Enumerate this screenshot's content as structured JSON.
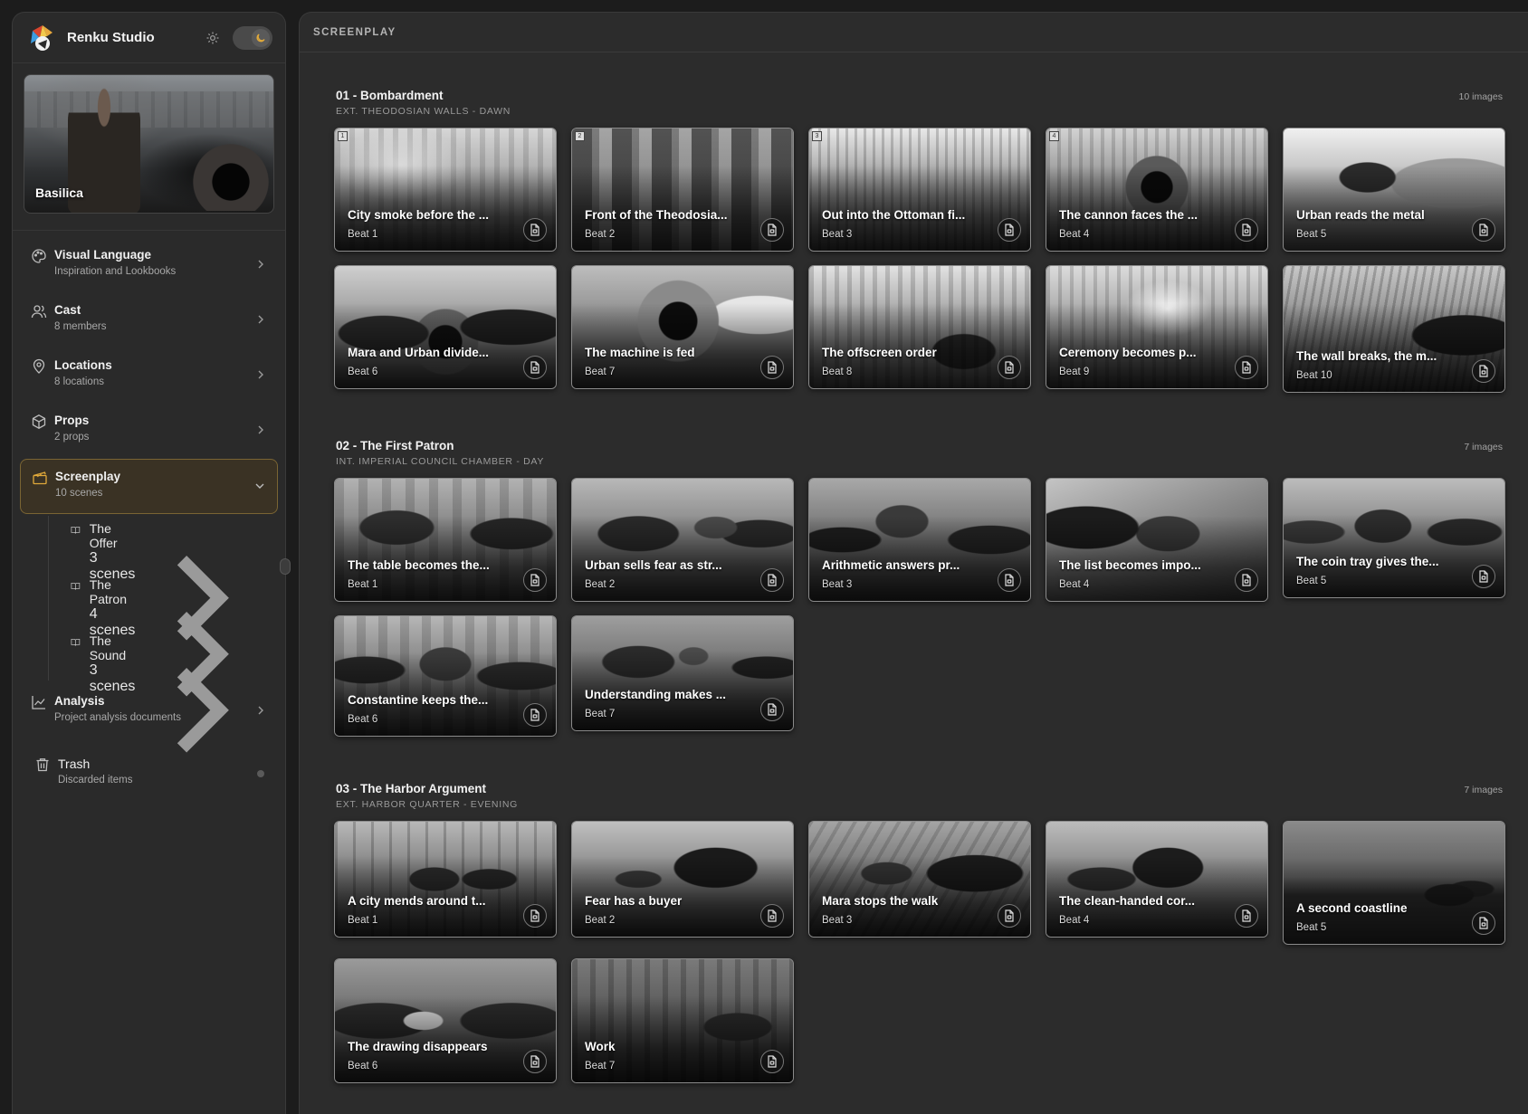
{
  "app": {
    "name": "Renku Studio"
  },
  "project": {
    "title": "Basilica"
  },
  "nav": {
    "visual_language": {
      "title": "Visual Language",
      "sub": "Inspiration and Lookbooks"
    },
    "cast": {
      "title": "Cast",
      "sub": "8 members"
    },
    "locations": {
      "title": "Locations",
      "sub": "8 locations"
    },
    "props": {
      "title": "Props",
      "sub": "2 props"
    },
    "screenplay": {
      "title": "Screenplay",
      "sub": "10 scenes"
    },
    "sequences": [
      {
        "title": "The Offer",
        "sub": "3 scenes"
      },
      {
        "title": "The Patron",
        "sub": "4 scenes"
      },
      {
        "title": "The Sound",
        "sub": "3 scenes"
      }
    ],
    "analysis": {
      "title": "Analysis",
      "sub": "Project analysis documents"
    },
    "trash": {
      "title": "Trash",
      "sub": "Discarded items"
    }
  },
  "main": {
    "header": "SCREENPLAY",
    "scenes": [
      {
        "title": "01 - Bombardment",
        "slug": "EXT. THEODOSIAN WALLS - DAWN",
        "count": "10 images",
        "beats": [
          {
            "title": "City smoke before the ...",
            "beat": "Beat 1",
            "badge": "1"
          },
          {
            "title": "Front of the Theodosia...",
            "beat": "Beat 2",
            "badge": "2"
          },
          {
            "title": "Out into the Ottoman fi...",
            "beat": "Beat 3",
            "badge": "3"
          },
          {
            "title": "The cannon faces the ...",
            "beat": "Beat 4",
            "badge": "4"
          },
          {
            "title": "Urban reads the metal",
            "beat": "Beat 5",
            "badge": ""
          },
          {
            "title": "Mara and Urban divide...",
            "beat": "Beat 6",
            "badge": ""
          },
          {
            "title": "The machine is fed",
            "beat": "Beat 7",
            "badge": ""
          },
          {
            "title": "The offscreen order",
            "beat": "Beat 8",
            "badge": ""
          },
          {
            "title": "Ceremony becomes p...",
            "beat": "Beat 9",
            "badge": ""
          },
          {
            "title": "The wall breaks, the m...",
            "beat": "Beat 10",
            "badge": ""
          }
        ]
      },
      {
        "title": "02 - The First Patron",
        "slug": "INT. IMPERIAL COUNCIL CHAMBER - DAY",
        "count": "7 images",
        "beats": [
          {
            "title": "The table becomes the...",
            "beat": "Beat 1"
          },
          {
            "title": "Urban sells fear as str...",
            "beat": "Beat 2"
          },
          {
            "title": "Arithmetic answers pr...",
            "beat": "Beat 3"
          },
          {
            "title": "The list becomes impo...",
            "beat": "Beat 4"
          },
          {
            "title": "The coin tray gives the...",
            "beat": "Beat 5"
          },
          {
            "title": "Constantine keeps the...",
            "beat": "Beat 6"
          },
          {
            "title": "Understanding makes ...",
            "beat": "Beat 7"
          }
        ]
      },
      {
        "title": "03 - The Harbor Argument",
        "slug": "EXT. HARBOR QUARTER - EVENING",
        "count": "7 images",
        "beats": [
          {
            "title": "A city mends around t...",
            "beat": "Beat 1"
          },
          {
            "title": "Fear has a buyer",
            "beat": "Beat 2"
          },
          {
            "title": "Mara stops the walk",
            "beat": "Beat 3"
          },
          {
            "title": "The clean-handed cor...",
            "beat": "Beat 4"
          },
          {
            "title": "A second coastline",
            "beat": "Beat 5"
          },
          {
            "title": "The drawing disappears",
            "beat": "Beat 6"
          },
          {
            "title": "Work",
            "beat": "Beat 7"
          }
        ]
      }
    ]
  },
  "colors": {
    "accent": "#e0a93a",
    "active_bg": "#3a3224",
    "active_border": "#7a6433"
  }
}
